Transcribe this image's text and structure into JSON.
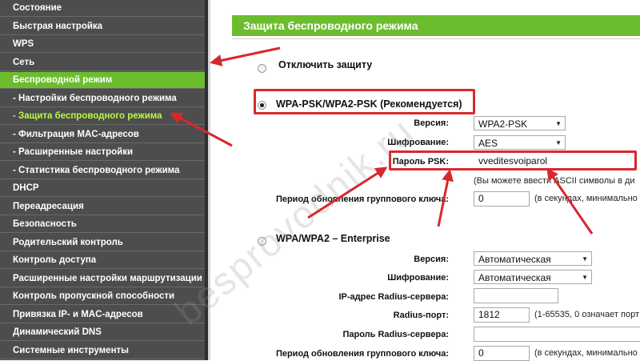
{
  "sidebar": {
    "items": [
      {
        "label": "Состояние",
        "type": "main"
      },
      {
        "label": "Быстрая настройка",
        "type": "main"
      },
      {
        "label": "WPS",
        "type": "main"
      },
      {
        "label": "Сеть",
        "type": "main"
      },
      {
        "label": "Беспроводной режим",
        "type": "active"
      },
      {
        "label": "- Настройки беспроводного режима",
        "type": "sub"
      },
      {
        "label": "- Защита беспроводного режима",
        "type": "current"
      },
      {
        "label": "- Фильтрация MAC-адресов",
        "type": "sub"
      },
      {
        "label": "- Расширенные настройки",
        "type": "sub"
      },
      {
        "label": "- Статистика беспроводного режима",
        "type": "sub"
      },
      {
        "label": "DHCP",
        "type": "main"
      },
      {
        "label": "Переадресация",
        "type": "main"
      },
      {
        "label": "Безопасность",
        "type": "main"
      },
      {
        "label": "Родительский контроль",
        "type": "main"
      },
      {
        "label": "Контроль доступа",
        "type": "main"
      },
      {
        "label": "Расширенные настройки маршрутизации",
        "type": "main"
      },
      {
        "label": "Контроль пропускной способности",
        "type": "main"
      },
      {
        "label": "Привязка IP- и MAC-адресов",
        "type": "main"
      },
      {
        "label": "Динамический DNS",
        "type": "main"
      },
      {
        "label": "Системные инструменты",
        "type": "main"
      }
    ]
  },
  "main": {
    "title": "Защита беспроводного режима",
    "disable": {
      "label": "Отключить защиту"
    },
    "wpa_psk": {
      "label": "WPA-PSK/WPA2-PSK (Рекомендуется)",
      "version_label": "Версия:",
      "version_value": "WPA2-PSK",
      "encryption_label": "Шифрование:",
      "encryption_value": "AES",
      "psk_label": "Пароль PSK:",
      "psk_value": "vveditesvoiparol",
      "psk_hint": "(Вы можете ввести ASCII символы в ди",
      "group_key_label": "Период обновления группового ключа:",
      "group_key_value": "0",
      "group_key_hint": "(в секундах, минимально"
    },
    "enterprise": {
      "label": "WPA/WPA2 – Enterprise",
      "version_label": "Версия:",
      "version_value": "Автоматическая",
      "encryption_label": "Шифрование:",
      "encryption_value": "Автоматическая",
      "radius_ip_label": "IP-адрес Radius-сервера:",
      "radius_ip_value": "",
      "radius_port_label": "Radius-порт:",
      "radius_port_value": "1812",
      "radius_port_hint": "(1-65535, 0 означает порт по",
      "radius_pass_label": "Пароль Radius-сервера:",
      "radius_pass_value": "",
      "group_key_label": "Период обновления группового ключа:",
      "group_key_value": "0",
      "group_key_hint": "(в секундах, минимально"
    },
    "watermark": "besprovodnik.ru"
  },
  "colors": {
    "sidebar_bg": "#4d4d4d",
    "accent_green": "#6cbd2e",
    "current_item_text": "#b6ff3a",
    "annotation_red": "#d7282e"
  },
  "icons": {
    "select_arrow": "chevron-down-icon",
    "radio": "radio-icon"
  }
}
